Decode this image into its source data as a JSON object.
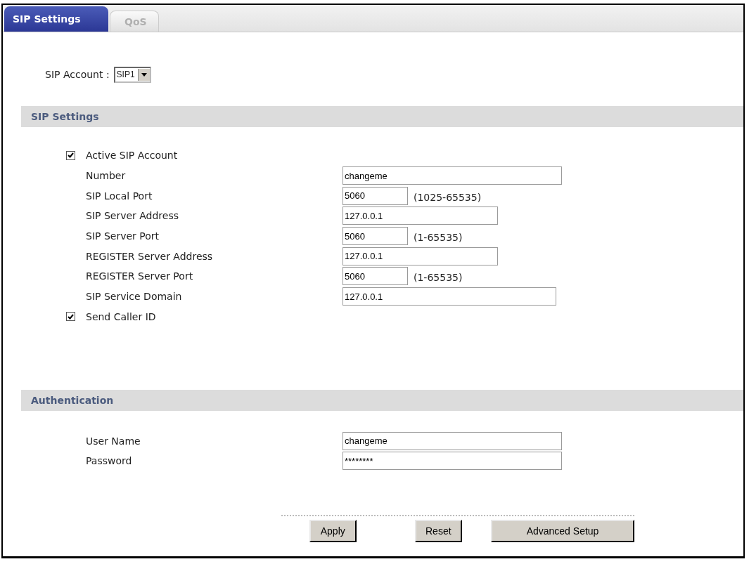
{
  "tabs": [
    {
      "label": "SIP Settings",
      "selected": true
    },
    {
      "label": "QoS",
      "selected": false
    }
  ],
  "account": {
    "label": "SIP Account :",
    "value": "SIP1"
  },
  "sections": [
    {
      "title": "SIP Settings",
      "rows": [
        {
          "kind": "checkbox",
          "label": "Active SIP Account",
          "checked": true
        },
        {
          "kind": "long",
          "label": "Number",
          "value": "changeme"
        },
        {
          "kind": "port",
          "label": "SIP Local Port",
          "value": "5060",
          "hint": "(1025-65535)"
        },
        {
          "kind": "address",
          "label": "SIP Server Address",
          "value": "127.0.0.1"
        },
        {
          "kind": "port",
          "label": "SIP Server Port",
          "value": "5060",
          "hint": "(1-65535)"
        },
        {
          "kind": "address",
          "label": "REGISTER Server Address",
          "value": "127.0.0.1"
        },
        {
          "kind": "port",
          "label": "REGISTER Server Port",
          "value": "5060",
          "hint": "(1-65535)"
        },
        {
          "kind": "domain",
          "label": "SIP Service Domain",
          "value": "127.0.0.1"
        },
        {
          "kind": "checkbox",
          "label": "Send Caller ID",
          "checked": true
        }
      ]
    },
    {
      "title": "Authentication",
      "rows": [
        {
          "kind": "long",
          "label": "User Name",
          "value": "changeme"
        },
        {
          "kind": "long",
          "label": "Password",
          "value": "********"
        }
      ]
    }
  ],
  "buttons": [
    "Apply",
    "Reset",
    "Advanced Setup"
  ]
}
